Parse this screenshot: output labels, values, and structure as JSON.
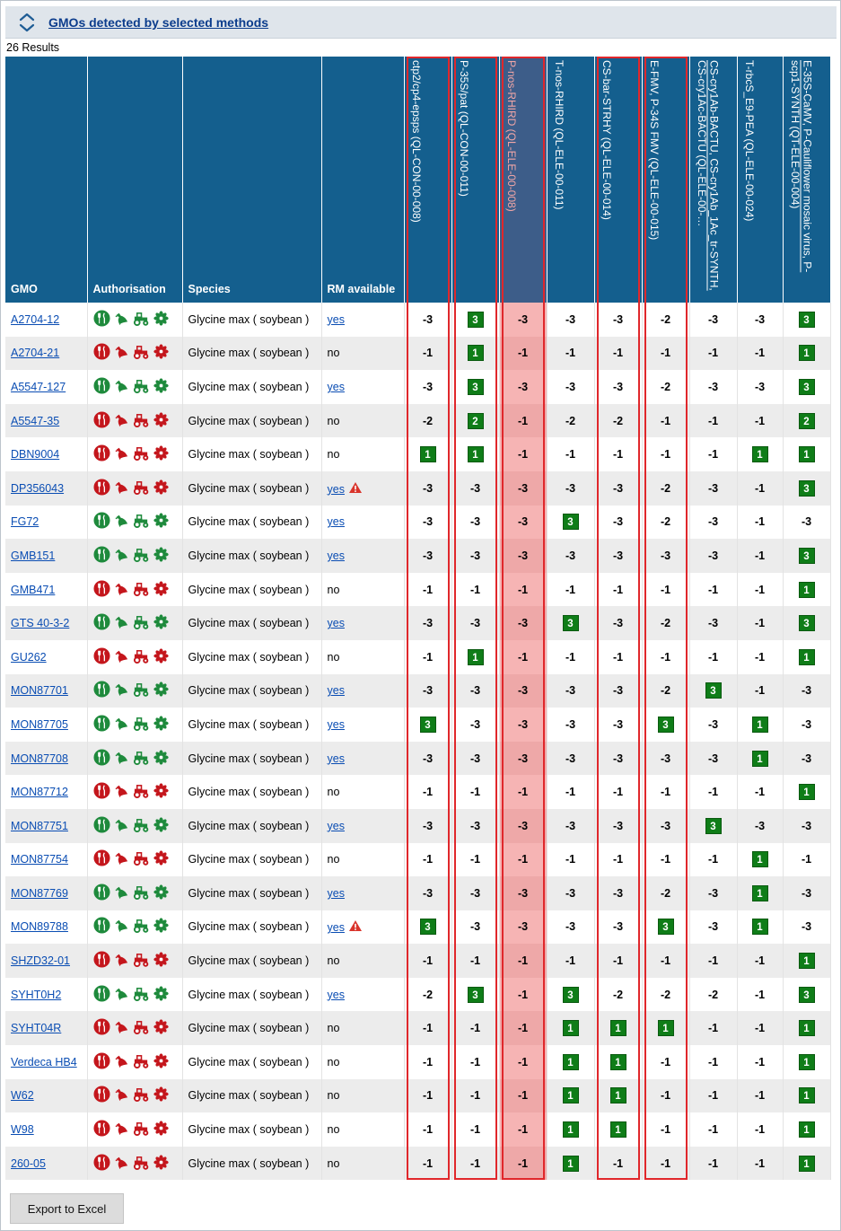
{
  "section": {
    "title": "GMOs detected by selected methods"
  },
  "results_count": "26 Results",
  "columns": {
    "gmo": "GMO",
    "authorisation": "Authorisation",
    "species": "Species",
    "rm": "RM available"
  },
  "methods": [
    {
      "label": "ctp2/cp4-epsps (QL-CON-00-008)",
      "boxed": true,
      "highlighted": false
    },
    {
      "label": "P-35S/pat (QL-CON-00-011)",
      "boxed": true,
      "highlighted": false
    },
    {
      "label": "P-nos-RHIRD (QL-ELE-00-008)",
      "boxed": true,
      "highlighted": true
    },
    {
      "label": "T-nos-RHIRD (QL-ELE-00-011)",
      "boxed": false,
      "highlighted": false
    },
    {
      "label": "CS-bar-STRHY (QL-ELE-00-014)",
      "boxed": true,
      "highlighted": false
    },
    {
      "label": "E-FMV, P-34S FMV (QL-ELE-00-015)",
      "boxed": true,
      "highlighted": false
    },
    {
      "label": "CS-cry1Ab-BACTU, CS-cry1Ab_1Ac_tr-SYNTH, CS-cry1Ac-BACTU (QL-ELE-00-…",
      "boxed": false,
      "highlighted": false
    },
    {
      "label": "T-rbcS_E9-PEA (QL-ELE-00-024)",
      "boxed": false,
      "highlighted": false
    },
    {
      "label": "E-35S-CaMV, P-Cauliflower mosaic virus, P-scp1-SYNTH (QT-ELE-00-004)",
      "boxed": false,
      "highlighted": false
    }
  ],
  "colors": {
    "authorised": "#1e8a3c",
    "not_authorised": "#c4161c",
    "header": "#145f8e",
    "positive": "#0f7d18",
    "highlight": "#f6b4b4",
    "box": "#e0272b"
  },
  "rows": [
    {
      "gmo": "A2704-12",
      "auth": "green",
      "species": "Glycine max ( soybean )",
      "rm": "yes",
      "rm_link": true,
      "warn": false,
      "values": [
        "-3",
        "3",
        "-3",
        "-3",
        "-3",
        "-2",
        "-3",
        "-3",
        "3"
      ]
    },
    {
      "gmo": "A2704-21",
      "auth": "red",
      "species": "Glycine max ( soybean )",
      "rm": "no",
      "rm_link": false,
      "warn": false,
      "values": [
        "-1",
        "1",
        "-1",
        "-1",
        "-1",
        "-1",
        "-1",
        "-1",
        "1"
      ]
    },
    {
      "gmo": "A5547-127",
      "auth": "green",
      "species": "Glycine max ( soybean )",
      "rm": "yes",
      "rm_link": true,
      "warn": false,
      "values": [
        "-3",
        "3",
        "-3",
        "-3",
        "-3",
        "-2",
        "-3",
        "-3",
        "3"
      ]
    },
    {
      "gmo": "A5547-35",
      "auth": "red",
      "species": "Glycine max ( soybean )",
      "rm": "no",
      "rm_link": false,
      "warn": false,
      "values": [
        "-2",
        "2",
        "-1",
        "-2",
        "-2",
        "-1",
        "-1",
        "-1",
        "2"
      ]
    },
    {
      "gmo": "DBN9004",
      "auth": "red",
      "species": "Glycine max ( soybean )",
      "rm": "no",
      "rm_link": false,
      "warn": false,
      "values": [
        "1",
        "1",
        "-1",
        "-1",
        "-1",
        "-1",
        "-1",
        "1",
        "1"
      ]
    },
    {
      "gmo": "DP356043",
      "auth": "red",
      "species": "Glycine max ( soybean )",
      "rm": "yes",
      "rm_link": true,
      "warn": true,
      "values": [
        "-3",
        "-3",
        "-3",
        "-3",
        "-3",
        "-2",
        "-3",
        "-1",
        "3"
      ]
    },
    {
      "gmo": "FG72",
      "auth": "green",
      "species": "Glycine max ( soybean )",
      "rm": "yes",
      "rm_link": true,
      "warn": false,
      "values": [
        "-3",
        "-3",
        "-3",
        "3",
        "-3",
        "-2",
        "-3",
        "-1",
        "-3"
      ]
    },
    {
      "gmo": "GMB151",
      "auth": "green",
      "species": "Glycine max ( soybean )",
      "rm": "yes",
      "rm_link": true,
      "warn": false,
      "values": [
        "-3",
        "-3",
        "-3",
        "-3",
        "-3",
        "-3",
        "-3",
        "-1",
        "3"
      ]
    },
    {
      "gmo": "GMB471",
      "auth": "red",
      "species": "Glycine max ( soybean )",
      "rm": "no",
      "rm_link": false,
      "warn": false,
      "values": [
        "-1",
        "-1",
        "-1",
        "-1",
        "-1",
        "-1",
        "-1",
        "-1",
        "1"
      ]
    },
    {
      "gmo": "GTS 40-3-2",
      "auth": "green",
      "species": "Glycine max ( soybean )",
      "rm": "yes",
      "rm_link": true,
      "warn": false,
      "values": [
        "-3",
        "-3",
        "-3",
        "3",
        "-3",
        "-2",
        "-3",
        "-1",
        "3"
      ]
    },
    {
      "gmo": "GU262",
      "auth": "red",
      "species": "Glycine max ( soybean )",
      "rm": "no",
      "rm_link": false,
      "warn": false,
      "values": [
        "-1",
        "1",
        "-1",
        "-1",
        "-1",
        "-1",
        "-1",
        "-1",
        "1"
      ]
    },
    {
      "gmo": "MON87701",
      "auth": "green",
      "species": "Glycine max ( soybean )",
      "rm": "yes",
      "rm_link": true,
      "warn": false,
      "values": [
        "-3",
        "-3",
        "-3",
        "-3",
        "-3",
        "-2",
        "3",
        "-1",
        "-3"
      ]
    },
    {
      "gmo": "MON87705",
      "auth": "green",
      "species": "Glycine max ( soybean )",
      "rm": "yes",
      "rm_link": true,
      "warn": false,
      "values": [
        "3",
        "-3",
        "-3",
        "-3",
        "-3",
        "3",
        "-3",
        "1",
        "-3"
      ]
    },
    {
      "gmo": "MON87708",
      "auth": "green",
      "species": "Glycine max ( soybean )",
      "rm": "yes",
      "rm_link": true,
      "warn": false,
      "values": [
        "-3",
        "-3",
        "-3",
        "-3",
        "-3",
        "-3",
        "-3",
        "1",
        "-3"
      ]
    },
    {
      "gmo": "MON87712",
      "auth": "red",
      "species": "Glycine max ( soybean )",
      "rm": "no",
      "rm_link": false,
      "warn": false,
      "values": [
        "-1",
        "-1",
        "-1",
        "-1",
        "-1",
        "-1",
        "-1",
        "-1",
        "1"
      ]
    },
    {
      "gmo": "MON87751",
      "auth": "green",
      "species": "Glycine max ( soybean )",
      "rm": "yes",
      "rm_link": true,
      "warn": false,
      "values": [
        "-3",
        "-3",
        "-3",
        "-3",
        "-3",
        "-3",
        "3",
        "-3",
        "-3"
      ]
    },
    {
      "gmo": "MON87754",
      "auth": "red",
      "species": "Glycine max ( soybean )",
      "rm": "no",
      "rm_link": false,
      "warn": false,
      "values": [
        "-1",
        "-1",
        "-1",
        "-1",
        "-1",
        "-1",
        "-1",
        "1",
        "-1"
      ]
    },
    {
      "gmo": "MON87769",
      "auth": "green",
      "species": "Glycine max ( soybean )",
      "rm": "yes",
      "rm_link": true,
      "warn": false,
      "values": [
        "-3",
        "-3",
        "-3",
        "-3",
        "-3",
        "-2",
        "-3",
        "1",
        "-3"
      ]
    },
    {
      "gmo": "MON89788",
      "auth": "green",
      "species": "Glycine max ( soybean )",
      "rm": "yes",
      "rm_link": true,
      "warn": true,
      "values": [
        "3",
        "-3",
        "-3",
        "-3",
        "-3",
        "3",
        "-3",
        "1",
        "-3"
      ]
    },
    {
      "gmo": "SHZD32-01",
      "auth": "red",
      "species": "Glycine max ( soybean )",
      "rm": "no",
      "rm_link": false,
      "warn": false,
      "values": [
        "-1",
        "-1",
        "-1",
        "-1",
        "-1",
        "-1",
        "-1",
        "-1",
        "1"
      ]
    },
    {
      "gmo": "SYHT0H2",
      "auth": "green",
      "species": "Glycine max ( soybean )",
      "rm": "yes",
      "rm_link": true,
      "warn": false,
      "values": [
        "-2",
        "3",
        "-1",
        "3",
        "-2",
        "-2",
        "-2",
        "-1",
        "3"
      ]
    },
    {
      "gmo": "SYHT04R",
      "auth": "red",
      "species": "Glycine max ( soybean )",
      "rm": "no",
      "rm_link": false,
      "warn": false,
      "values": [
        "-1",
        "-1",
        "-1",
        "1",
        "1",
        "1",
        "-1",
        "-1",
        "1"
      ]
    },
    {
      "gmo": "Verdeca HB4",
      "auth": "red",
      "species": "Glycine max ( soybean )",
      "rm": "no",
      "rm_link": false,
      "warn": false,
      "values": [
        "-1",
        "-1",
        "-1",
        "1",
        "1",
        "-1",
        "-1",
        "-1",
        "1"
      ]
    },
    {
      "gmo": "W62",
      "auth": "red",
      "species": "Glycine max ( soybean )",
      "rm": "no",
      "rm_link": false,
      "warn": false,
      "values": [
        "-1",
        "-1",
        "-1",
        "1",
        "1",
        "-1",
        "-1",
        "-1",
        "1"
      ]
    },
    {
      "gmo": "W98",
      "auth": "red",
      "species": "Glycine max ( soybean )",
      "rm": "no",
      "rm_link": false,
      "warn": false,
      "values": [
        "-1",
        "-1",
        "-1",
        "1",
        "1",
        "-1",
        "-1",
        "-1",
        "1"
      ]
    },
    {
      "gmo": "260-05",
      "auth": "red",
      "species": "Glycine max ( soybean )",
      "rm": "no",
      "rm_link": false,
      "warn": false,
      "values": [
        "-1",
        "-1",
        "-1",
        "1",
        "-1",
        "-1",
        "-1",
        "-1",
        "1"
      ]
    }
  ],
  "export_button": "Export to Excel"
}
